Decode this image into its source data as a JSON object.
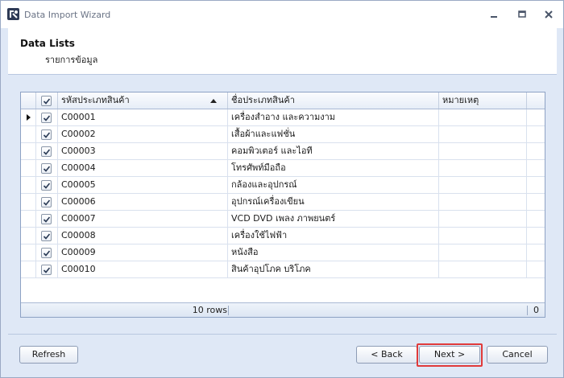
{
  "window": {
    "title": "Data Import Wizard"
  },
  "header": {
    "title": "Data Lists",
    "subtitle": "รายการข้อมูล"
  },
  "grid": {
    "columns": [
      "รหัสประเภทสินค้า",
      "ชื่อประเภทสินค้า",
      "หมายเหตุ"
    ],
    "sorted_column": "รหัสประเภทสินค้า",
    "sort_direction": "ascending",
    "rows": [
      {
        "checked": true,
        "code": "C00001",
        "name": "เครื่องสำอาง และความงาม",
        "note": ""
      },
      {
        "checked": true,
        "code": "C00002",
        "name": "เสื้อผ้าและแฟชั่น",
        "note": ""
      },
      {
        "checked": true,
        "code": "C00003",
        "name": "คอมพิวเตอร์ และไอที",
        "note": ""
      },
      {
        "checked": true,
        "code": "C00004",
        "name": "โทรศัพท์มือถือ",
        "note": ""
      },
      {
        "checked": true,
        "code": "C00005",
        "name": "กล้องและอุปกรณ์",
        "note": ""
      },
      {
        "checked": true,
        "code": "C00006",
        "name": "อุปกรณ์เครื่องเขียน",
        "note": ""
      },
      {
        "checked": true,
        "code": "C00007",
        "name": "VCD DVD เพลง ภาพยนตร์",
        "note": ""
      },
      {
        "checked": true,
        "code": "C00008",
        "name": "เครื่องใช้ไฟฟ้า",
        "note": ""
      },
      {
        "checked": true,
        "code": "C00009",
        "name": "หนังสือ",
        "note": ""
      },
      {
        "checked": true,
        "code": "C00010",
        "name": "สินค้าอุปโภค บริโภค",
        "note": ""
      }
    ],
    "footer": {
      "row_count": "10 rows",
      "total": "0"
    }
  },
  "buttons": {
    "refresh": "Refresh",
    "back": "< Back",
    "next": "Next >",
    "cancel": "Cancel"
  },
  "colors": {
    "accent_highlight": "#e03a3a",
    "frame": "#dfe8f6"
  },
  "icons": {
    "app": "wizard-app-icon",
    "minimize": "minimize-icon",
    "maximize": "maximize-icon",
    "close": "close-icon",
    "checkbox": "checkbox-checked-icon",
    "sort": "sort-ascending-icon",
    "row_indicator": "current-row-indicator-icon"
  }
}
